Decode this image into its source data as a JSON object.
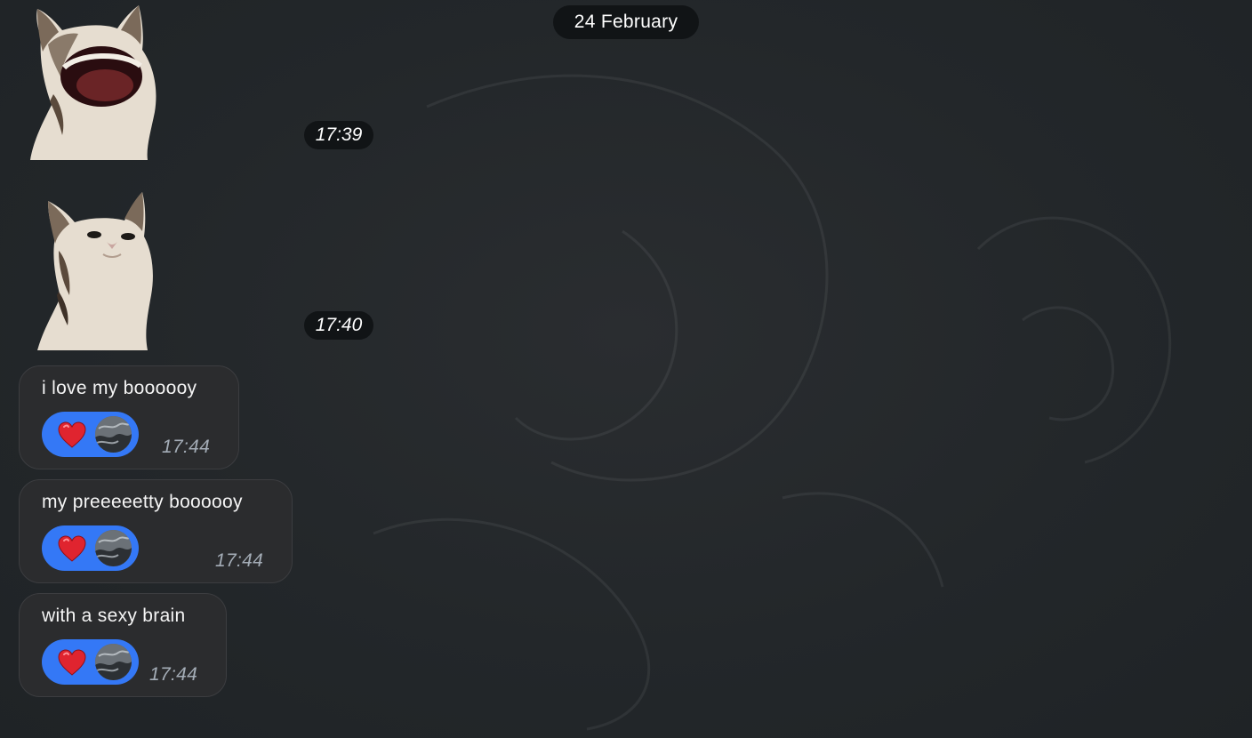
{
  "chat": {
    "date_separator": "24 February",
    "stickers": [
      {
        "depicts": "cat-open-mouth-sticker",
        "time": "17:39"
      },
      {
        "depicts": "cat-closed-mouth-sticker",
        "time": "17:40"
      }
    ],
    "messages": [
      {
        "text": "i love my boooooy",
        "time": "17:44",
        "reaction": {
          "emoji": "heart",
          "count_avatars": 1
        }
      },
      {
        "text": "my preeeeetty boooooy",
        "time": "17:44",
        "reaction": {
          "emoji": "heart",
          "count_avatars": 1
        }
      },
      {
        "text": "with a sexy brain",
        "time": "17:44",
        "reaction": {
          "emoji": "heart",
          "count_avatars": 1
        }
      }
    ]
  },
  "colors": {
    "background": "#23272a",
    "pill": "#111416",
    "bubble": "#2b2c2e",
    "reaction": "#3478f6",
    "heart": "#e0242f",
    "timestamp": "#a4adb7"
  }
}
